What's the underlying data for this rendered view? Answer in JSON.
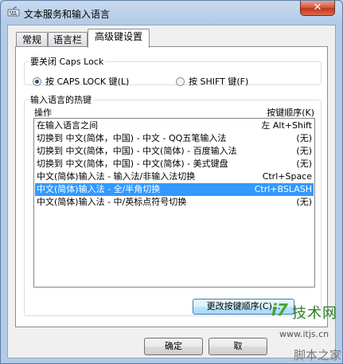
{
  "window": {
    "title": "文本服务和输入语言",
    "close_glyph": "✕"
  },
  "tabs": [
    {
      "label": "常规"
    },
    {
      "label": "语言栏"
    },
    {
      "label": "高级键设置"
    }
  ],
  "caps_lock": {
    "legend": "要关闭 Caps Lock",
    "option1": "按 CAPS LOCK 键(L)",
    "option2": "按 SHIFT 键(F)",
    "selected": 1
  },
  "hotkeys": {
    "legend": "输入语言的热键",
    "col_action": "操作",
    "col_key": "按键顺序(K)",
    "rows": [
      {
        "action": "在输入语言之间",
        "key": "左 Alt+Shift"
      },
      {
        "action": "切换到 中文(简体，中国) - 中文 - QQ五笔输入法",
        "key": "(无)"
      },
      {
        "action": "切换到 中文(简体，中国) - 中文(简体) - 百度输入法",
        "key": "(无)"
      },
      {
        "action": "切换到 中文(简体，中国) - 中文(简体) - 美式键盘",
        "key": "(无)"
      },
      {
        "action": "中文(简体)输入法 - 输入法/非输入法切换",
        "key": "Ctrl+Space"
      },
      {
        "action": "中文(简体)输入法 - 全/半角切换",
        "key": "Ctrl+BSLASH"
      },
      {
        "action": "中文(简体)输入法 - 中/英标点符号切换",
        "key": "(无)"
      }
    ],
    "selected_index": 5,
    "change_button": "更改按键顺序(C)..."
  },
  "footer": {
    "ok": "确定",
    "cancel": "取"
  },
  "watermark": {
    "logo": "i7",
    "text": "技术网",
    "url": "www.itjs.cn",
    "sub": "脚本之家"
  },
  "colors": {
    "selection": "#3399ff",
    "close": "#c2341a"
  }
}
